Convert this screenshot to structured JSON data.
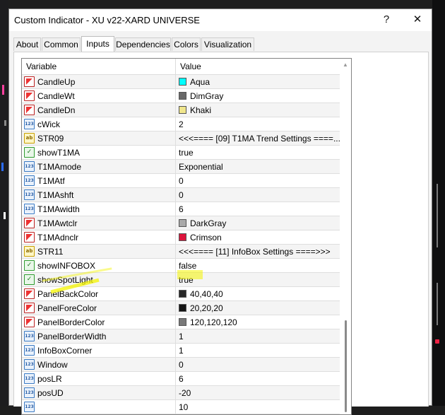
{
  "window": {
    "title": "Custom Indicator - XU v22-XARD UNIVERSE",
    "help_label": "?",
    "close_label": "✕"
  },
  "tabs": [
    {
      "label": "About",
      "active": false
    },
    {
      "label": "Common",
      "active": false
    },
    {
      "label": "Inputs",
      "active": true
    },
    {
      "label": "Dependencies",
      "active": false
    },
    {
      "label": "Colors",
      "active": false
    },
    {
      "label": "Visualization",
      "active": false
    }
  ],
  "grid": {
    "col_variable": "Variable",
    "col_value": "Value",
    "rows": [
      {
        "type": "color",
        "name": "CandleUp",
        "value": "Aqua",
        "swatch": "#00ffff"
      },
      {
        "type": "color",
        "name": "CandleWt",
        "value": "DimGray",
        "swatch": "#696969"
      },
      {
        "type": "color",
        "name": "CandleDn",
        "value": "Khaki",
        "swatch": "#f0e68c"
      },
      {
        "type": "num",
        "name": "cWick",
        "value": "2"
      },
      {
        "type": "str",
        "name": "STR09",
        "value": "<<<==== [09] T1MA Trend Settings ====..."
      },
      {
        "type": "bool",
        "name": "showT1MA",
        "value": "true"
      },
      {
        "type": "num",
        "name": "T1MAmode",
        "value": "Exponential"
      },
      {
        "type": "num",
        "name": "T1MAtf",
        "value": "0"
      },
      {
        "type": "num",
        "name": "T1MAshft",
        "value": "0"
      },
      {
        "type": "num",
        "name": "T1MAwidth",
        "value": "6"
      },
      {
        "type": "color",
        "name": "T1MAwtclr",
        "value": "DarkGray",
        "swatch": "#a9a9a9"
      },
      {
        "type": "color",
        "name": "T1MAdnclr",
        "value": "Crimson",
        "swatch": "#dc143c"
      },
      {
        "type": "str",
        "name": "STR11",
        "value": "<<<==== [11] InfoBox Settings ====>>>"
      },
      {
        "type": "bool",
        "name": "showINFOBOX",
        "value": "false"
      },
      {
        "type": "bool",
        "name": "showSpotLight",
        "value": "true"
      },
      {
        "type": "color",
        "name": "PanelBackColor",
        "value": "40,40,40",
        "swatch": "#282828"
      },
      {
        "type": "color",
        "name": "PanelForeColor",
        "value": "20,20,20",
        "swatch": "#141414"
      },
      {
        "type": "color",
        "name": "PanelBorderColor",
        "value": "120,120,120",
        "swatch": "#787878"
      },
      {
        "type": "num",
        "name": "PanelBorderWidth",
        "value": "1"
      },
      {
        "type": "num",
        "name": "InfoBoxCorner",
        "value": "1"
      },
      {
        "type": "num",
        "name": "Window",
        "value": "0"
      },
      {
        "type": "num",
        "name": "posLR",
        "value": "6"
      },
      {
        "type": "num",
        "name": "posUD",
        "value": "-20"
      },
      {
        "type": "num",
        "name": "",
        "value": "10"
      }
    ]
  },
  "icons": {
    "color": "color-icon",
    "num": "number-icon",
    "str": "string-icon",
    "bool": "bool-icon"
  },
  "icon_text": {
    "num": "123",
    "str": "ab",
    "bool": "✓"
  },
  "highlight_color": "#f4f400"
}
